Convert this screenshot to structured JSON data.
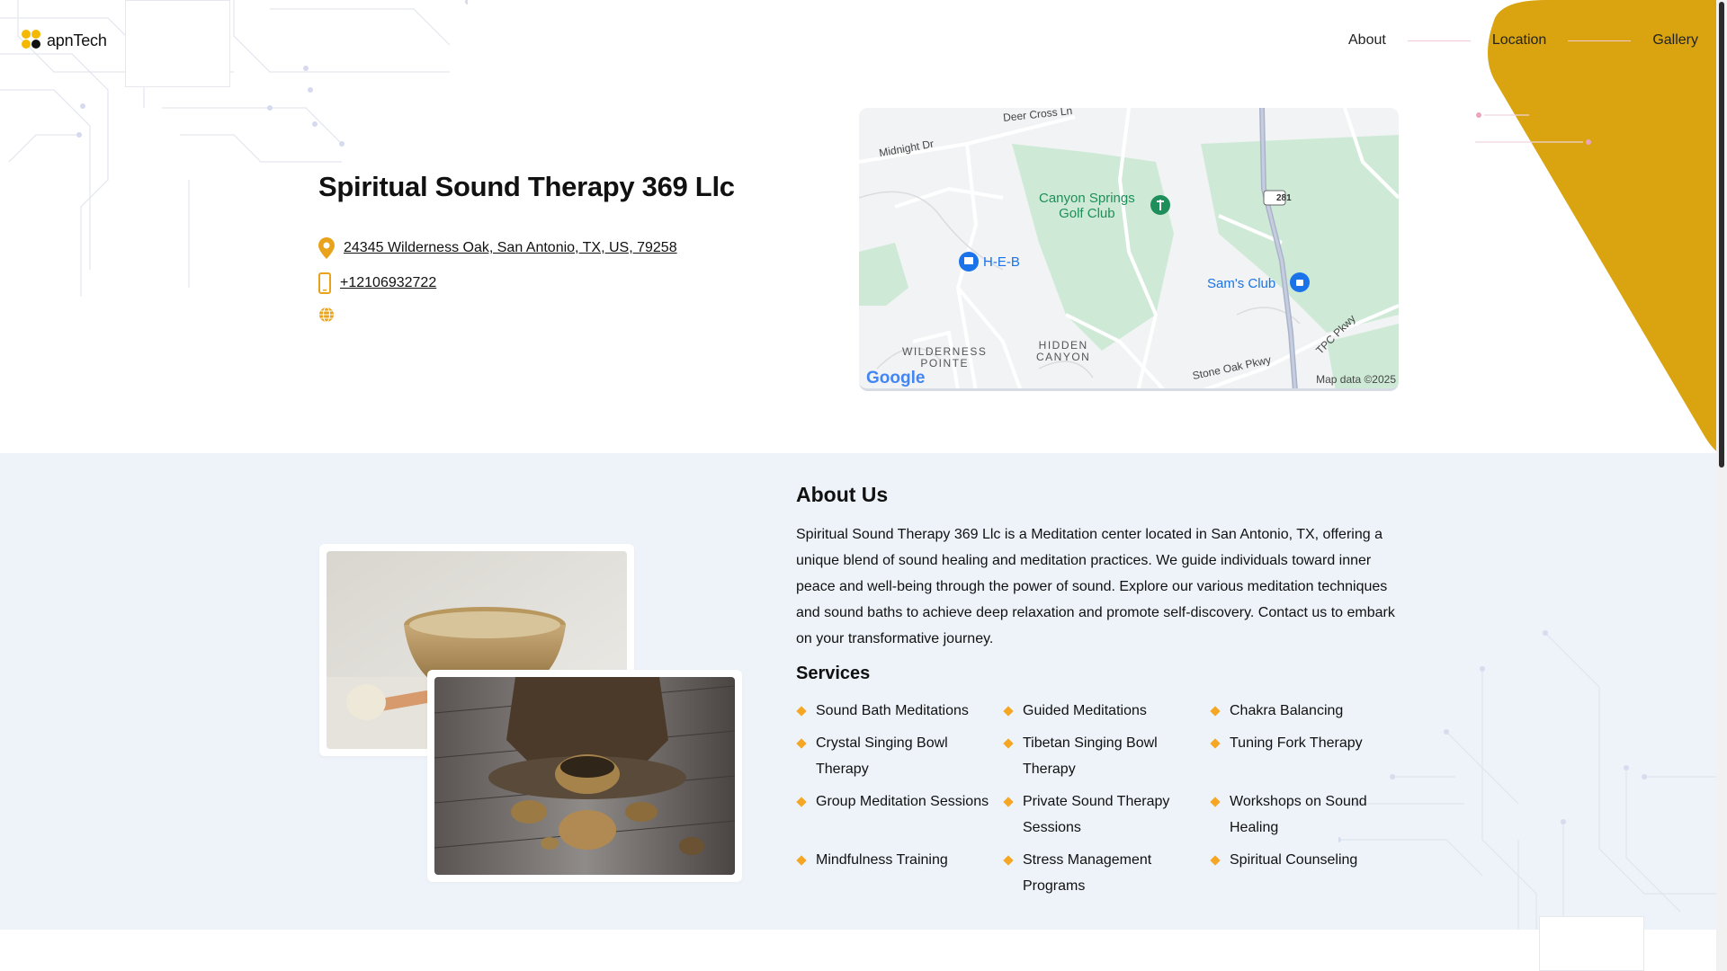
{
  "brand": {
    "logo_text": "apnTech",
    "dot_colors": [
      "#f5b800",
      "#f5b800",
      "#111111",
      "#f5b800"
    ]
  },
  "nav": {
    "items": [
      {
        "label": "About"
      },
      {
        "label": "Location"
      },
      {
        "label": "Gallery"
      }
    ]
  },
  "business": {
    "name": "Spiritual Sound Therapy 369 Llc",
    "address": "24345 Wilderness Oak, San Antonio, TX, US, 79258",
    "phone": "+12106932722",
    "icons": {
      "address": "map-pin-icon",
      "phone": "phone-icon",
      "website": "globe-icon"
    }
  },
  "map": {
    "labels": {
      "deer_cross": "Deer Cross Ln",
      "midnight": "Midnight Dr",
      "canyon_springs": "Canyon Springs\nGolf Club",
      "heb": "H-E-B",
      "sams": "Sam's Club",
      "highway": "281",
      "wilderness": "WILDERNESS\nPOINTE",
      "hidden": "HIDDEN\nCANYON",
      "stone_oak": "Stone Oak Pkwy",
      "tpc": "TPC Pkwy",
      "google": "Google",
      "attribution": "Map data ©2025"
    }
  },
  "about": {
    "heading": "About Us",
    "body": "Spiritual Sound Therapy 369 Llc is a Meditation center located in San Antonio, TX, offering a unique blend of sound healing and meditation practices. We guide individuals toward inner peace and well-being through the power of sound. Explore our various meditation techniques and sound baths to achieve deep relaxation and promote self-discovery. Contact us to embark on your transformative journey.",
    "services_heading": "Services",
    "services": [
      "Sound Bath Meditations",
      "Guided Meditations",
      "Chakra Balancing",
      "Crystal Singing Bowl Therapy",
      "Tibetan Singing Bowl Therapy",
      "Tuning Fork Therapy",
      "Group Meditation Sessions",
      "Private Sound Therapy Sessions",
      "Workshops on Sound Healing",
      "Mindfulness Training",
      "Stress Management Programs",
      "Spiritual Counseling"
    ]
  },
  "colors": {
    "accent": "#d9a40f",
    "bullet": "#f5a623",
    "band": "#eef3fa"
  }
}
